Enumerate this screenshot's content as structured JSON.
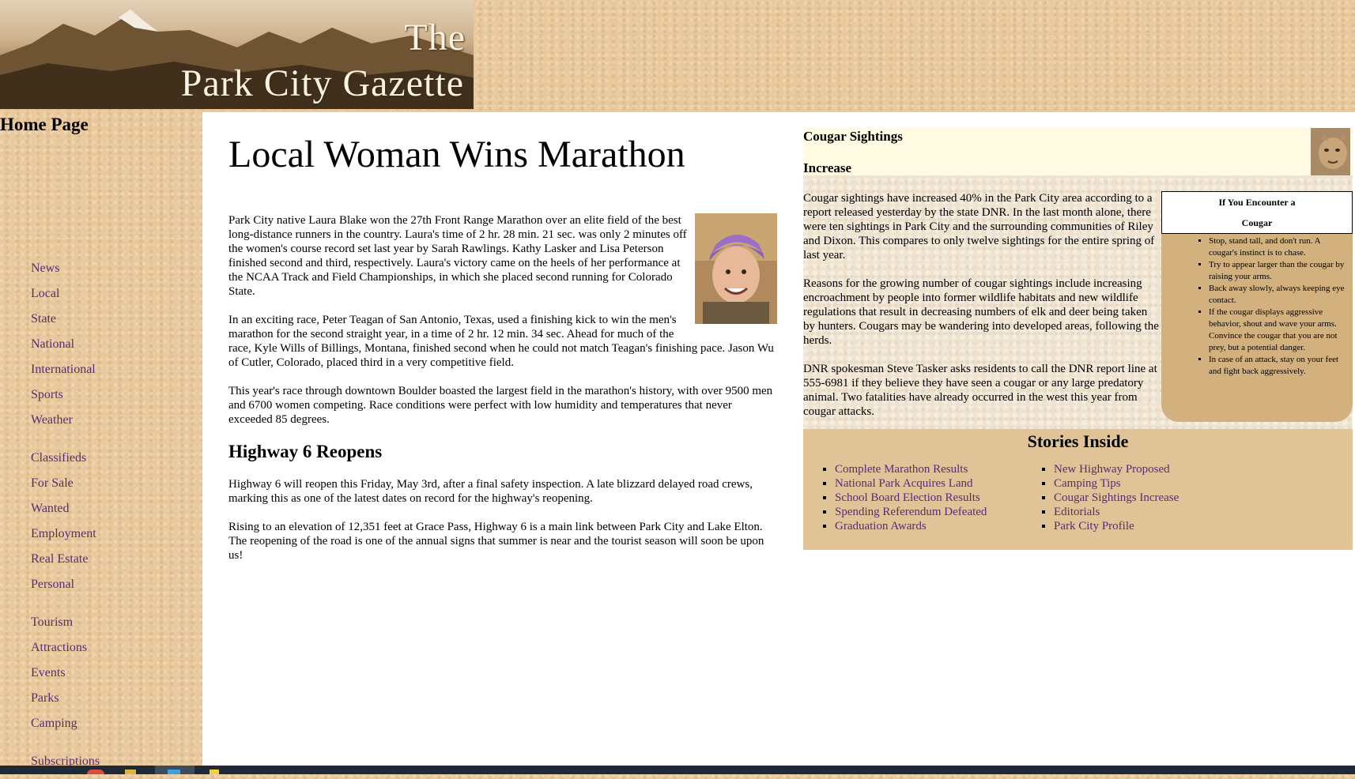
{
  "banner": {
    "the": "The",
    "title": "Park City Gazette"
  },
  "sidebar": {
    "home": "Home Page",
    "groups": [
      [
        "News",
        "Local",
        "State",
        "National",
        "International",
        "Sports",
        "Weather"
      ],
      [
        "Classifieds",
        "For Sale",
        "Wanted",
        "Employment",
        "Real Estate",
        "Personal"
      ],
      [
        "Tourism",
        "Attractions",
        "Events",
        "Parks",
        "Camping"
      ],
      [
        "Subscriptions"
      ]
    ]
  },
  "article": {
    "headline": "Local Woman Wins Marathon",
    "paragraphs": [
      "Park City native Laura Blake won the 27th Front Range Marathon over an elite field of the best long-distance runners in the country. Laura's time of 2 hr. 28 min. 21 sec. was only 2 minutes off the women's course record set last year by Sarah Rawlings. Kathy Lasker and Lisa Peterson finished second and third, respectively. Laura's victory came on the heels of her performance at the NCAA Track and Field Championships, in which she placed second running for Colorado State.",
      "In an exciting race, Peter Teagan of San Antonio, Texas, used a finishing kick to win the men's marathon for the second straight year, in a time of 2 hr. 12 min. 34 sec. Ahead for much of the race, Kyle Wills of Billings, Montana, finished second when he could not match Teagan's finishing pace. Jason Wu of Cutler, Colorado, placed third in a very competitive field.",
      "This year's race through downtown Boulder boasted the largest field in the marathon's history, with over 9500 men and 6700 women competing. Race conditions were perfect with low humidity and temperatures that never exceeded 85 degrees."
    ],
    "subhead": "Highway 6 Reopens",
    "highway_paragraphs": [
      "Highway 6 will reopen this Friday, May 3rd, after a final safety inspection. A late blizzard delayed road crews, marking this as one of the latest dates on record for the highway's reopening.",
      "Rising to an elevation of 12,351 feet at Grace Pass, Highway 6 is a main link between Park City and Lake Elton. The reopening of the road is one of the annual signs that summer is near and the tourist season will soon be upon us!"
    ]
  },
  "cougar": {
    "title_line1": "Cougar Sightings",
    "title_line2": "Increase",
    "paragraphs": [
      "Cougar sightings have increased 40% in the Park City area according to a report released yesterday by the state DNR. In the last month alone, there were ten sightings in Park City and the surrounding communities of Riley and Dixon. This compares to only twelve sightings for the entire spring of last year.",
      "Reasons for the growing number of cougar sightings include increasing encroachment by people into former wildlife habitats and new wildlife regulations that result in decreasing numbers of elk and deer being taken by hunters. Cougars may be wandering into developed areas, following the herds.",
      "DNR spokesman Steve Tasker asks residents to call the DNR report line at 555-6981 if they believe they have seen a cougar or any large predatory animal. Two fatalities have already occurred in the west this year from cougar attacks."
    ],
    "box_title_line1": "If You Encounter a",
    "box_title_line2": "Cougar",
    "tips": [
      "Stop, stand tall, and don't run. A cougar's instinct is to chase.",
      "Try to appear larger than the cougar by raising your arms.",
      "Back away slowly, always keeping eye contact.",
      "If the cougar displays aggressive behavior, shout and wave your arms. Convince the cougar that you are not prey, but a potential danger.",
      "In case of an attack, stay on your feet and fight back aggressively."
    ]
  },
  "stories": {
    "title": "Stories Inside",
    "col1": [
      "Complete Marathon Results",
      "National Park Acquires Land",
      "School Board Election Results",
      "Spending Referendum Defeated",
      "Graduation Awards"
    ],
    "col2": [
      "New Highway Proposed",
      "Camping Tips",
      "Cougar Sightings Increase",
      "Editorials",
      "Park City Profile"
    ]
  },
  "colors": {
    "page_background": "#e9c99c",
    "link": "#5a2a7a",
    "cougar_header": "#fffbe3",
    "encounter_box": "#d2b17f",
    "stories_background": "#e0c497",
    "taskbar": "#1e2a35"
  },
  "icons": [
    "mountain-banner-image",
    "runner-photo",
    "cougar-photo",
    "chrome-icon",
    "folder-icon",
    "edge-icon",
    "warning-icon"
  ]
}
